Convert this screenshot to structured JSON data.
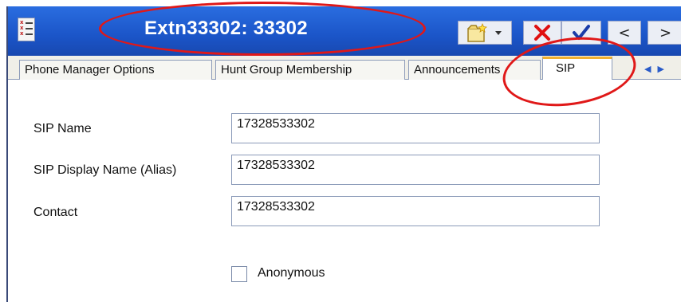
{
  "window": {
    "title": "Extn33302: 33302"
  },
  "toolbar": {
    "icons": [
      "new-icon",
      "dropdown-arrow-icon",
      "delete-icon",
      "ok-check-icon",
      "previous-icon",
      "next-icon"
    ],
    "prev_glyph": "<",
    "next_glyph": ">"
  },
  "tabs": [
    {
      "label": "Phone Manager Options",
      "active": false
    },
    {
      "label": "Hunt Group Membership",
      "active": false
    },
    {
      "label": "Announcements",
      "active": false
    },
    {
      "label": "SIP",
      "active": true
    }
  ],
  "form": {
    "sip_name_label": "SIP Name",
    "sip_name_value": "17328533302",
    "sip_display_name_label": "SIP Display Name (Alias)",
    "sip_display_name_value": "17328533302",
    "contact_label": "Contact",
    "contact_value": "17328533302",
    "anonymous_label": "Anonymous",
    "anonymous_checked": false
  },
  "colors": {
    "titlebar": "#1b55c8",
    "annotation": "#e01818",
    "active_tab_accent": "#f0b030"
  }
}
